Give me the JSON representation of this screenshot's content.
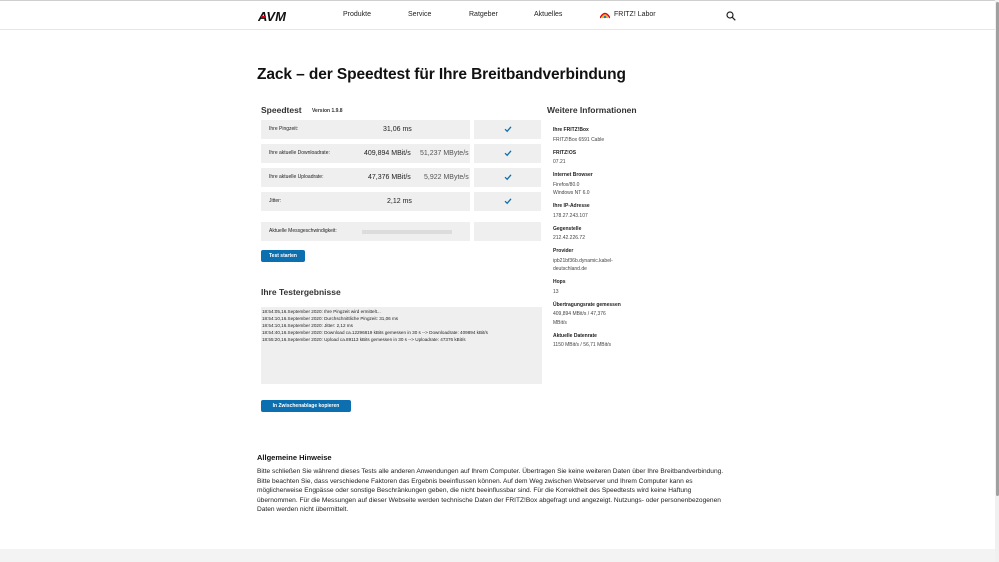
{
  "nav": {
    "logo_alt": "AVM",
    "items": [
      "Produkte",
      "Service",
      "Ratgeber",
      "Aktuelles",
      "FRITZ! Labor"
    ]
  },
  "page_title": "Zack – der Speedtest für Ihre Breitbandverbindung",
  "speedtest": {
    "title": "Speedtest",
    "version": "Version 1.9.8",
    "rows": [
      {
        "label": "Ihre Pingzeit:",
        "value": "31,06 ms",
        "value2": ""
      },
      {
        "label": "Ihre aktuelle Downloadrate:",
        "value": "409,894 MBit/s",
        "value2": "51,237 MByte/s"
      },
      {
        "label": "Ihre aktuelle Uploadrate:",
        "value": "47,376 MBit/s",
        "value2": "5,922 MByte/s"
      },
      {
        "label": "Jitter:",
        "value": "2,12 ms",
        "value2": ""
      }
    ],
    "current_speed_label": "Aktuelle Messgeschwindigkeit:",
    "current_speed_progress": 0,
    "start_button": "Test starten"
  },
  "results": {
    "title": "Ihre Testergebnisse",
    "lines": [
      "18:54:05,16.September 2020: Ihre Pingzeit wird ermittelt...",
      "18:54:10,16.September 2020: Durchschnittliche Pingzeit: 31,06 ms",
      "18:54:10,16.September 2020: Jitter: 2,12 ms",
      "18:54:40,16.September 2020: Download ca.12296819 kBits gemessen in 30 s --> Downloadrate: 409894 kBit/s",
      "18:55:20,16.September 2020: Upload ca.89113 kBits gemessen in 30 s --> Uploadrate: 47376 kBit/s"
    ],
    "copy_button": "In Zwischenablage kopieren"
  },
  "info": {
    "title": "Weitere Informationen",
    "items": [
      {
        "label": "Ihre FRITZ!Box",
        "lines": [
          "FRITZ!Box 6591 Cable"
        ]
      },
      {
        "label": "FRITZ!OS",
        "lines": [
          "07.21"
        ]
      },
      {
        "label": "Internet Browser",
        "lines": [
          "Firefox/80.0",
          "Windows NT 6.0"
        ]
      },
      {
        "label": "Ihre IP-Adresse",
        "lines": [
          "178.27.243.107"
        ]
      },
      {
        "label": "Gegenstelle",
        "lines": [
          "212.42.226.72"
        ]
      },
      {
        "label": "Provider",
        "lines": [
          "ipb21bf36b.dynamic.kabel-",
          "deutschland.de"
        ]
      },
      {
        "label": "Hops",
        "lines": [
          "13"
        ]
      },
      {
        "label": "Übertragungsrate gemessen",
        "lines": [
          "409,894 MBit/s / 47,376",
          "MBit/s"
        ]
      },
      {
        "label": "Aktuelle Datenrate",
        "lines": [
          "1150 MBit/s / 56,71 MBit/s"
        ]
      }
    ]
  },
  "notes": {
    "title": "Allgemeine Hinweise",
    "text": "Bitte schließen Sie während dieses Tests alle anderen Anwendungen auf Ihrem Computer. Übertragen Sie keine weiteren Daten über Ihre Breitbandverbindung. Bitte beachten Sie, dass verschiedene Faktoren das Ergebnis beeinflussen können. Auf dem Weg zwischen Webserver und Ihrem Computer kann es möglicherweise Engpässe oder sonstige Beschränkungen geben, die nicht beeinflussbar sind. Für die Korrektheit des Speedtests wird keine Haftung übernommen. Für die Messungen auf dieser Webseite werden technische Daten der FRITZ!Box abgefragt und angezeigt. Nutzungs- oder personenbezogenen Daten werden nicht übermittelt."
  },
  "colors": {
    "accent": "#0b6fb0",
    "row_bg": "#efefef",
    "logo_red": "#e2001a"
  },
  "icons": [
    "avm-logo",
    "fritz-labor-icon",
    "search-icon",
    "checkmark-icon"
  ]
}
